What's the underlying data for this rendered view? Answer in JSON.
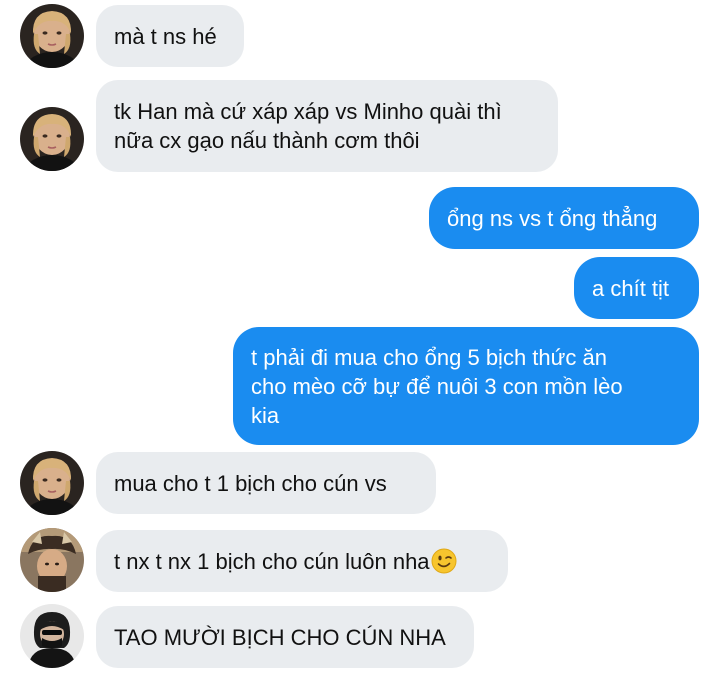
{
  "messages": [
    {
      "side": "in",
      "avatar": "avatar-1",
      "text": "mà t ns hé"
    },
    {
      "side": "in",
      "avatar": "avatar-1",
      "text": "tk Han mà cứ xáp xáp vs Minho quài thì\nnữa cx gạo nấu thành cơm thôi"
    },
    {
      "side": "out",
      "text": "ổng ns vs t ổng thẳng"
    },
    {
      "side": "out",
      "text": "a chít tịt"
    },
    {
      "side": "out",
      "text": "t phải đi mua cho ổng 5 bịch thức ăn\ncho mèo cỡ bự để nuôi 3 con mồn lèo\nkia"
    },
    {
      "side": "in",
      "avatar": "avatar-1",
      "text": "mua cho t 1 bịch cho cún vs"
    },
    {
      "side": "in",
      "avatar": "avatar-2",
      "text": "t nx t nx 1 bịch cho cún luôn nha",
      "emoji": "winking-face-emoji"
    },
    {
      "side": "in",
      "avatar": "avatar-3",
      "text": "TAO MƯỜI BỊCH CHO CÚN NHA"
    }
  ],
  "colors": {
    "incoming_bubble": "#e9ecef",
    "outgoing_bubble": "#1a8cf0",
    "background": "#ffffff"
  }
}
